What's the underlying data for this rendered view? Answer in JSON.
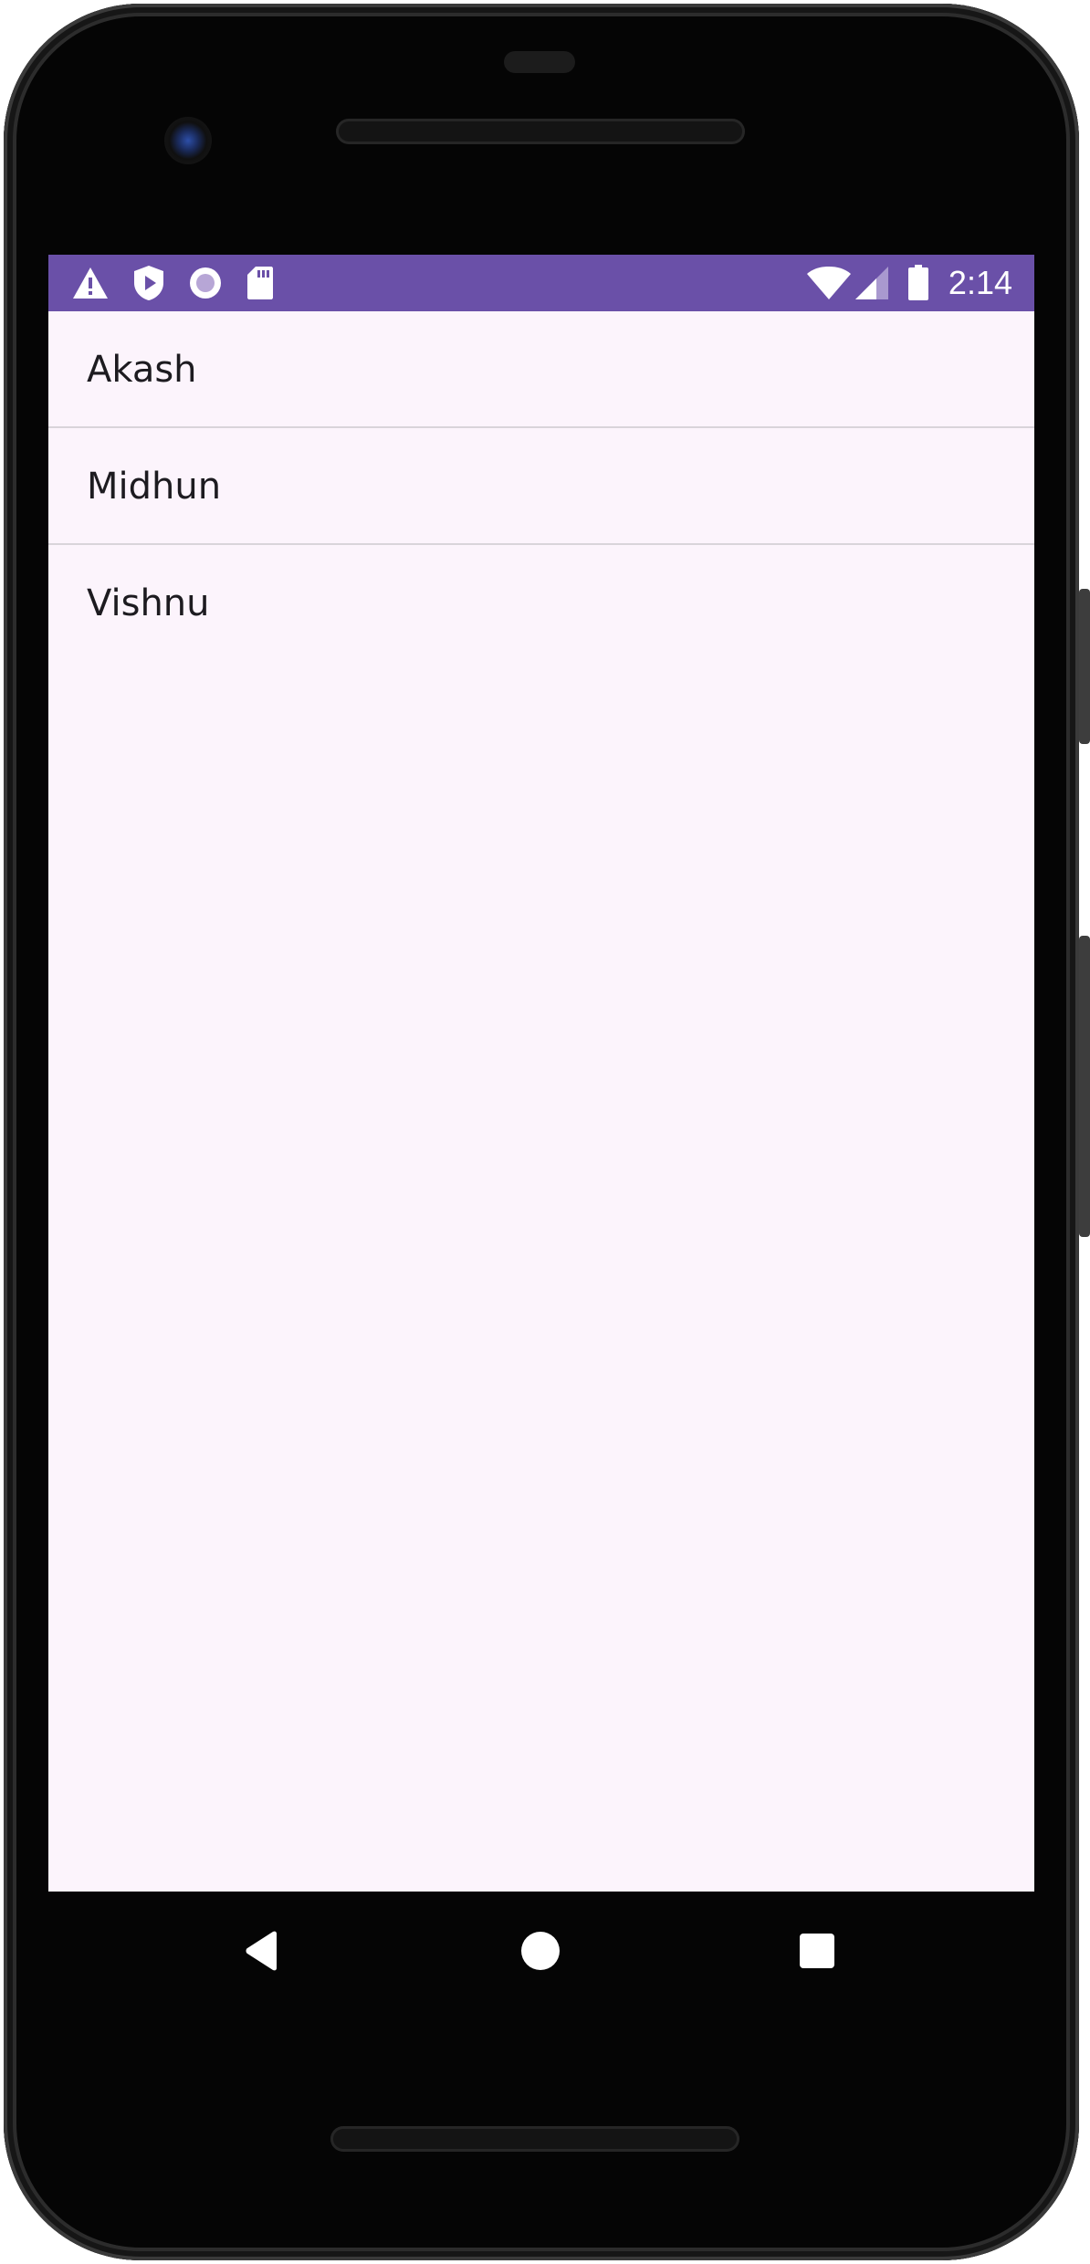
{
  "status_bar": {
    "time": "2:14",
    "left_icons": [
      "warning-icon",
      "shield-play-icon",
      "record-circle-icon",
      "sd-card-icon"
    ],
    "right_icons": [
      "wifi-icon",
      "signal-icon",
      "battery-icon"
    ],
    "color": "#6a50a8"
  },
  "list": {
    "items": [
      {
        "label": "Akash"
      },
      {
        "label": "Midhun"
      },
      {
        "label": "Vishnu"
      }
    ]
  },
  "nav_bar": {
    "buttons": [
      "back-icon",
      "home-icon",
      "recents-icon"
    ]
  },
  "colors": {
    "screen_background": "#fcf4fc",
    "divider": "#d9d4da",
    "text": "#1d1b20"
  }
}
